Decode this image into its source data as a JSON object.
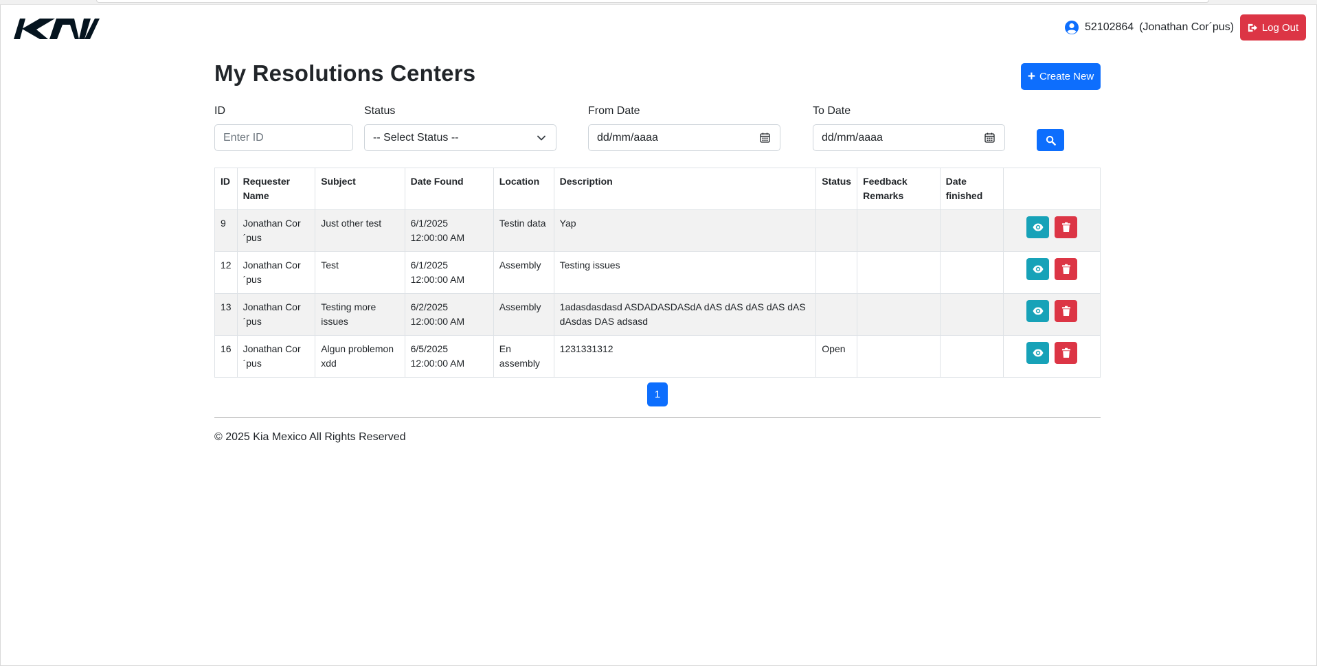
{
  "header": {
    "logo_text": "KIA",
    "user_id": "52102864",
    "user_name": "(Jonathan Cor´pus)",
    "logout_label": "Log Out"
  },
  "main": {
    "title": "My Resolutions Centers",
    "create_label": "Create New"
  },
  "filters": {
    "id_label": "ID",
    "id_placeholder": "Enter ID",
    "status_label": "Status",
    "status_value": "-- Select Status --",
    "from_label": "From Date",
    "from_value": "dd/mm/aaaa",
    "to_label": "To Date",
    "to_value": "dd/mm/aaaa"
  },
  "table": {
    "headers": {
      "id": "ID",
      "requester": "Requester Name",
      "subject": "Subject",
      "date_found": "Date Found",
      "location": "Location",
      "description": "Description",
      "status": "Status",
      "feedback": "Feedback Remarks",
      "date_finished": "Date finished"
    },
    "rows": [
      {
        "id": "9",
        "requester": "Jonathan Cor ´pus",
        "subject": "Just other test",
        "date_found": "6/1/2025 12:00:00 AM",
        "location": "Testin data",
        "description": "Yap",
        "status": "",
        "feedback": "",
        "date_finished": ""
      },
      {
        "id": "12",
        "requester": "Jonathan Cor ´pus",
        "subject": "Test",
        "date_found": "6/1/2025 12:00:00 AM",
        "location": "Assembly",
        "description": "Testing issues",
        "status": "",
        "feedback": "",
        "date_finished": ""
      },
      {
        "id": "13",
        "requester": "Jonathan Cor ´pus",
        "subject": "Testing more issues",
        "date_found": "6/2/2025 12:00:00 AM",
        "location": "Assembly",
        "description": "1adasdasdasd ASDADASDASdA dAS dAS dAS dAS dAS dAsdas DAS adsasd",
        "status": "",
        "feedback": "",
        "date_finished": ""
      },
      {
        "id": "16",
        "requester": "Jonathan Cor ´pus",
        "subject": "Algun problemon xdd",
        "date_found": "6/5/2025 12:00:00 AM",
        "location": "En assembly",
        "description": "1231331312",
        "status": "Open",
        "feedback": "",
        "date_finished": ""
      }
    ]
  },
  "pagination": {
    "current": "1"
  },
  "footer": {
    "text": "© 2025 Kia Mexico All Rights Reserved"
  },
  "colors": {
    "primary": "#0d6efd",
    "danger": "#dc3545",
    "info": "#17a2b8",
    "logo": "#05141f"
  },
  "icons": {
    "user": "user-circle-icon",
    "logout": "sign-out-icon",
    "create": "plus-icon",
    "select": "chevron-down-icon",
    "date": "calendar-icon",
    "search": "search-icon",
    "view": "eye-icon",
    "delete": "trash-icon"
  }
}
